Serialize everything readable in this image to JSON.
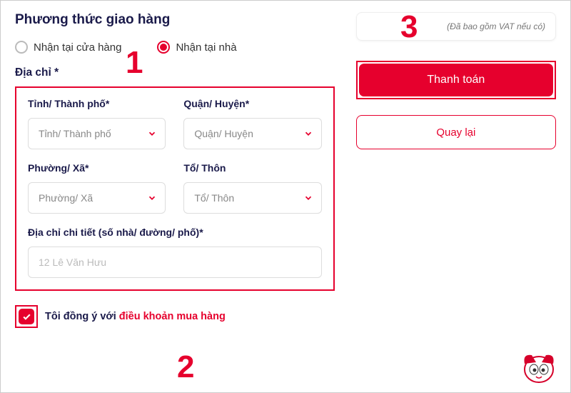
{
  "delivery": {
    "section_title": "Phương thức giao hàng",
    "option_pickup": "Nhận tại cửa hàng",
    "option_home": "Nhận tại nhà",
    "address_title": "Địa chỉ *"
  },
  "form": {
    "province": {
      "label": "Tỉnh/ Thành phố*",
      "placeholder": "Tỉnh/ Thành phố"
    },
    "district": {
      "label": "Quận/ Huyện*",
      "placeholder": "Quận/ Huyện"
    },
    "ward": {
      "label": "Phường/ Xã*",
      "placeholder": "Phường/ Xã"
    },
    "hamlet": {
      "label": "Tổ/ Thôn",
      "placeholder": "Tổ/ Thôn"
    },
    "detail": {
      "label": "Địa chỉ chi tiết (số nhà/ đường/ phố)*",
      "placeholder": "12 Lê Văn Hưu"
    }
  },
  "consent": {
    "prefix": "Tôi đồng ý với ",
    "link": "điều khoản mua hàng"
  },
  "summary": {
    "vat_note": "(Đã bao gồm VAT nếu có)",
    "checkout": "Thanh toán",
    "back": "Quay lại"
  },
  "annotations": {
    "one": "1",
    "two": "2",
    "three": "3"
  }
}
